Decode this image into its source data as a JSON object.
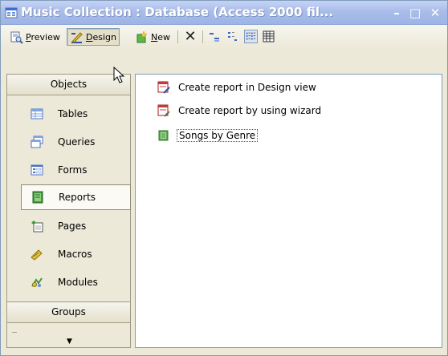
{
  "window": {
    "title": "Music Collection : Database (Access 2000 fil...",
    "minimize_glyph": "–",
    "maximize_glyph": "□",
    "close_glyph": "✕"
  },
  "toolbar": {
    "preview_label_u": "P",
    "preview_label_rest": "review",
    "design_label_pre": "",
    "design_label_u": "D",
    "design_label_rest": "esign",
    "new_label_u": "N",
    "new_label_rest": "ew",
    "delete_glyph": "✕",
    "view_icons": [
      "large-icons-icon",
      "small-icons-icon",
      "list-view-icon",
      "details-view-icon"
    ]
  },
  "sidebar": {
    "objects_header": "Objects",
    "items": [
      {
        "label": "Tables",
        "icon": "tables-icon"
      },
      {
        "label": "Queries",
        "icon": "queries-icon"
      },
      {
        "label": "Forms",
        "icon": "forms-icon"
      },
      {
        "label": "Reports",
        "icon": "reports-icon",
        "selected": true
      },
      {
        "label": "Pages",
        "icon": "pages-icon"
      },
      {
        "label": "Macros",
        "icon": "macros-icon"
      },
      {
        "label": "Modules",
        "icon": "modules-icon"
      }
    ],
    "groups_header": "Groups",
    "scroll_glyph": "▼"
  },
  "list": {
    "items": [
      {
        "label": "Create report in Design view",
        "icon": "report-design-icon"
      },
      {
        "label": "Create report by using wizard",
        "icon": "report-wizard-icon"
      },
      {
        "label": "Songs by Genre",
        "icon": "report-icon",
        "focused": true
      }
    ]
  },
  "colors": {
    "title_gradient_top": "#c6d3f7",
    "title_gradient_bottom": "#9db4e6",
    "window_face": "#ece9d8",
    "border_blue": "#7f9db9"
  }
}
